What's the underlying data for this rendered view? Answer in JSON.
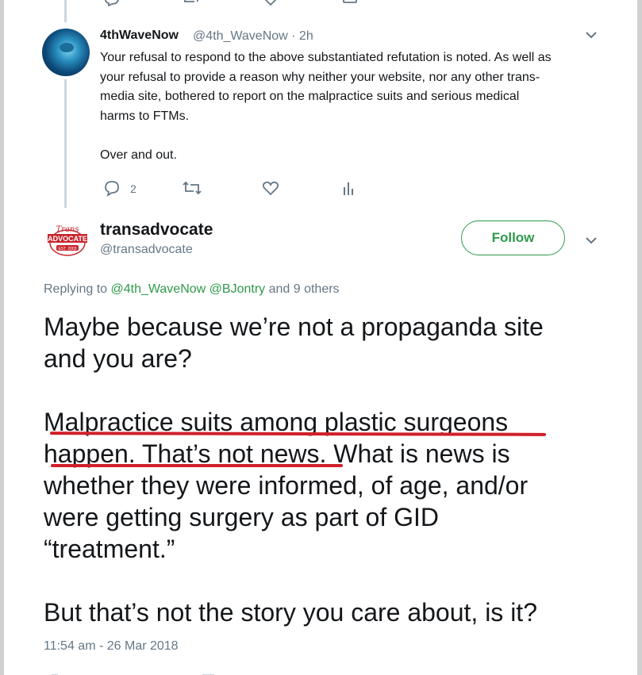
{
  "reply_tweet": {
    "author_name": "4thWaveNow",
    "author_handle": "@4th_WaveNow",
    "time": " · 2h",
    "body_lines": [
      "Your refusal to respond to the above substantiated refutation is noted. As well as",
      "your refusal to provide a reason why neither your website, nor any  other trans-",
      "media site,  bothered to report on the malpractice suits and serious medical",
      "harms to FTMs."
    ],
    "closing": "Over and out.",
    "reply_count": "2",
    "icons": [
      "reply-icon",
      "retweet-icon",
      "like-icon",
      "analytics-icon"
    ]
  },
  "main_tweet": {
    "author_name": "transadvocate",
    "author_handle": "@transadvocate",
    "follow_label": "Follow",
    "replying_prefix": "Replying to ",
    "replying_user1": "@4th_WaveNow",
    "replying_user2": "@BJontry",
    "replying_suffix": " and 9 others",
    "para1_line1": "Maybe because we’re not a propaganda site",
    "para1_line2": "and you are?",
    "para2_line1": "Malpractice suits among plastic surgeons",
    "para2_line2": "happen. That’s not news. What is news is",
    "para2_line3": "whether they were informed, of age, and/or",
    "para2_line4": "were getting surgery as part of GID",
    "para2_line5": "“treatment.”",
    "para3_line1": "But that’s not the story you care about, is it?",
    "timestamp": "11:54 am - 26 Mar 2018",
    "logo_text_top": "Trans",
    "logo_text_main": "ADVOCATE",
    "logo_text_badge": "EST. 2003"
  },
  "colors": {
    "accent_green": "#2e9a4a",
    "text": "#14171a",
    "secondary": "#657786",
    "annotation_red": "#d0202a"
  }
}
